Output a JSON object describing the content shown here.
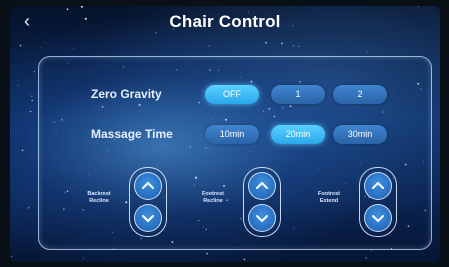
{
  "header": {
    "title": "Chair Control",
    "back_glyph": "‹"
  },
  "zero_gravity": {
    "label": "Zero Gravity",
    "options": [
      "OFF",
      "1",
      "2"
    ],
    "selected": "OFF"
  },
  "massage_time": {
    "label": "Massage Time",
    "options": [
      "10min",
      "20min",
      "30min"
    ],
    "selected": "20min"
  },
  "controls": [
    {
      "label_line1": "Backrest",
      "label_line2": "Recline",
      "up_icon": "chevron-up-icon",
      "down_icon": "chevron-down-icon"
    },
    {
      "label_line1": "Footrest",
      "label_line2": "Recline",
      "up_icon": "chevron-up-icon",
      "down_icon": "chevron-down-icon"
    },
    {
      "label_line1": "Footrest",
      "label_line2": "Extend",
      "up_icon": "chevron-up-icon",
      "down_icon": "chevron-down-icon"
    }
  ],
  "colors": {
    "pill": "#2f6fb8",
    "pill_active": "#3ab8f5",
    "text": "#ffffff"
  }
}
